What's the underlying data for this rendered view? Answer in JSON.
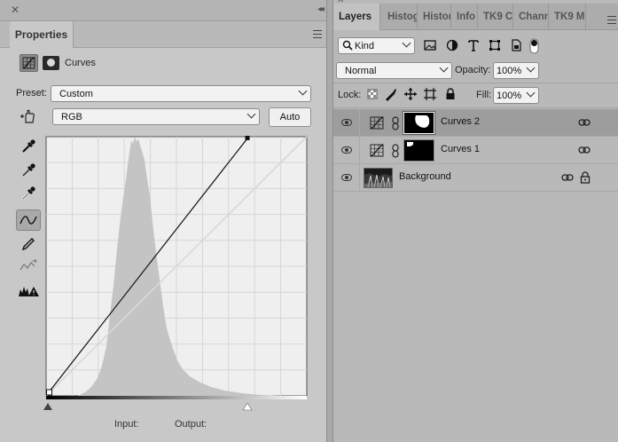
{
  "properties": {
    "title": "Properties",
    "adjustment_name": "Curves",
    "preset_label": "Preset:",
    "preset_value": "Custom",
    "channel_value": "RGB",
    "auto_label": "Auto",
    "input_label": "Input:",
    "output_label": "Output:",
    "tools": [
      "sample-shadow-eyedropper",
      "sample-midtone-eyedropper",
      "sample-highlight-eyedropper",
      "edit-points-curve",
      "draw-pencil",
      "smooth-curve",
      "clipping-warning"
    ]
  },
  "layers": {
    "tabs": [
      "Layers",
      "Histog",
      "Histor",
      "Info",
      "TK9 C",
      "Chann",
      "TK9 M"
    ],
    "filter_value": "Kind",
    "blend_mode": "Normal",
    "opacity_label": "Opacity:",
    "opacity_value": "100%",
    "lock_label": "Lock:",
    "fill_label": "Fill:",
    "fill_value": "100%",
    "rows": [
      {
        "name": "Curves 2",
        "selected": true
      },
      {
        "name": "Curves 1",
        "selected": false
      },
      {
        "name": "Background",
        "selected": false
      }
    ]
  },
  "colors": {
    "selected_row": "#9d9d9d",
    "panel_bg": "#c8c8c8",
    "graph_bg": "#efefef"
  }
}
